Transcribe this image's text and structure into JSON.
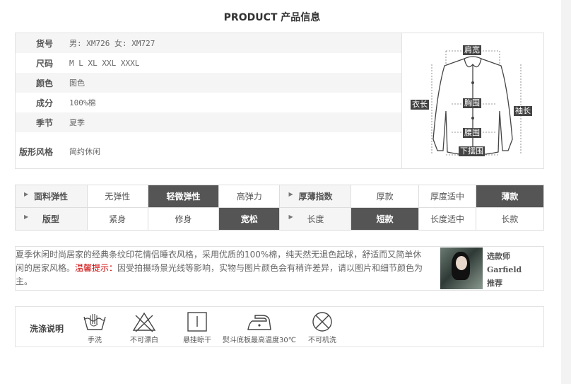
{
  "title": "PRODUCT 产品信息",
  "info": [
    {
      "label": "货号",
      "value": "男: XM726 女: XM727"
    },
    {
      "label": "尺码",
      "value": "M L XL XXL XXXL"
    },
    {
      "label": "颜色",
      "value": "图色"
    },
    {
      "label": "成分",
      "value": "100%棉"
    },
    {
      "label": "季节",
      "value": "夏季"
    },
    {
      "label": "版形风格",
      "value": "简约休闲"
    }
  ],
  "diagram_labels": {
    "shoulder": "肩宽",
    "length": "衣长",
    "sleeve": "袖长",
    "chest": "胸围",
    "waist": "腰围",
    "hem": "下摆围"
  },
  "attributes": {
    "row1": {
      "head1": "面料弹性",
      "opts1": [
        "无弹性",
        "轻微弹性",
        "高弹力"
      ],
      "head2": "厚薄指数",
      "opts2": [
        "厚款",
        "厚度适中",
        "薄款"
      ]
    },
    "row2": {
      "head1": "版型",
      "opts1": [
        "紧身",
        "修身",
        "宽松"
      ],
      "head2": "长度",
      "opts2": [
        "短款",
        "长度适中",
        "长款"
      ]
    }
  },
  "description": {
    "text": "夏季休闲时尚居家的经典条纹印花情侣睡衣风格，采用优质的100%棉，纯天然无退色起球，舒适而又简单休闲的居家风格。",
    "warn_label": "温馨提示：",
    "warn_text": "因受拍摄场景光线等影响，实物与图片颜色会有稍许差异，请以图片和细节颜色为主。"
  },
  "designer": {
    "line1": "选款师",
    "line2": "Garfield",
    "line3": "推荐"
  },
  "wash": {
    "title": "洗涤说明",
    "items": [
      "手洗",
      "不可漂白",
      "悬挂晾干",
      "熨斗底板最高温度30℃",
      "不可机洗"
    ]
  }
}
